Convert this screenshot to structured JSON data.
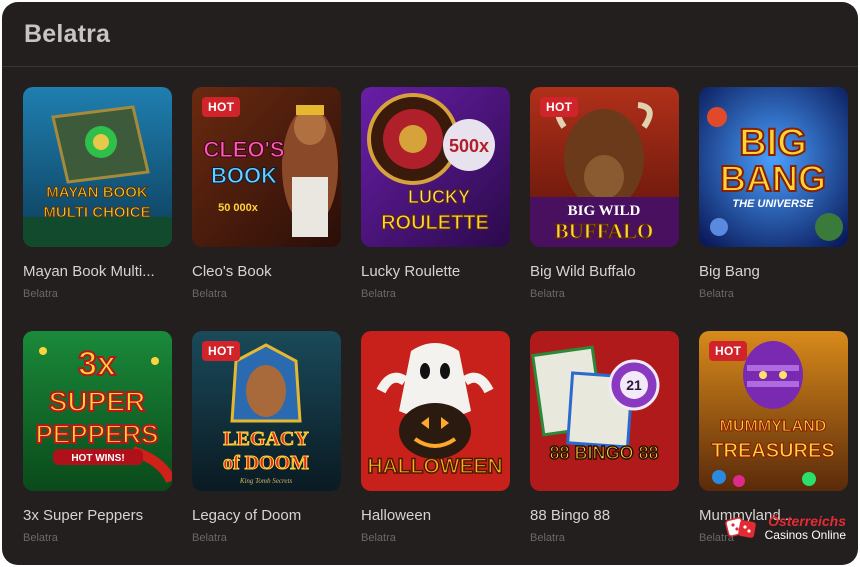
{
  "section": {
    "title": "Belatra"
  },
  "hot_label": "HOT",
  "games": [
    {
      "name": "Mayan Book Multi...",
      "provider": "Belatra",
      "hot": false,
      "art_text": [
        "MAYAN BOOK",
        "MULTI CHOICE"
      ]
    },
    {
      "name": "Cleo's Book",
      "provider": "Belatra",
      "hot": true,
      "art_text": [
        "CLEO'S",
        "BOOK",
        "50 000x"
      ]
    },
    {
      "name": "Lucky Roulette",
      "provider": "Belatra",
      "hot": false,
      "art_text": [
        "LUCKY",
        "ROULETTE",
        "500x"
      ]
    },
    {
      "name": "Big Wild Buffalo",
      "provider": "Belatra",
      "hot": true,
      "art_text": [
        "BIG WILD",
        "BUFFALO"
      ]
    },
    {
      "name": "Big Bang",
      "provider": "Belatra",
      "hot": false,
      "art_text": [
        "BIG",
        "BANG",
        "THE UNIVERSE"
      ]
    },
    {
      "name": "3x Super Peppers",
      "provider": "Belatra",
      "hot": false,
      "art_text": [
        "3x",
        "SUPER",
        "PEPPERS",
        "HOT WINS!"
      ]
    },
    {
      "name": "Legacy of Doom",
      "provider": "Belatra",
      "hot": true,
      "art_text": [
        "LEGACY",
        "of DOOM",
        "King Tomb Secrets"
      ]
    },
    {
      "name": "Halloween",
      "provider": "Belatra",
      "hot": false,
      "art_text": [
        "HALLOWEEN"
      ]
    },
    {
      "name": "88 Bingo 88",
      "provider": "Belatra",
      "hot": false,
      "art_text": [
        "88 BINGO 88",
        "21"
      ]
    },
    {
      "name": "Mummyland...",
      "provider": "Belatra",
      "hot": true,
      "art_text": [
        "MUMMYLAND",
        "TREASURES"
      ]
    }
  ],
  "watermark": {
    "line1": "Österreichs",
    "line2": "Casinos Online"
  },
  "colors": {
    "background": "#231f1e",
    "hot_badge": "#d1232a",
    "title": "#c9c4c1",
    "watermark_red": "#e32b33"
  }
}
